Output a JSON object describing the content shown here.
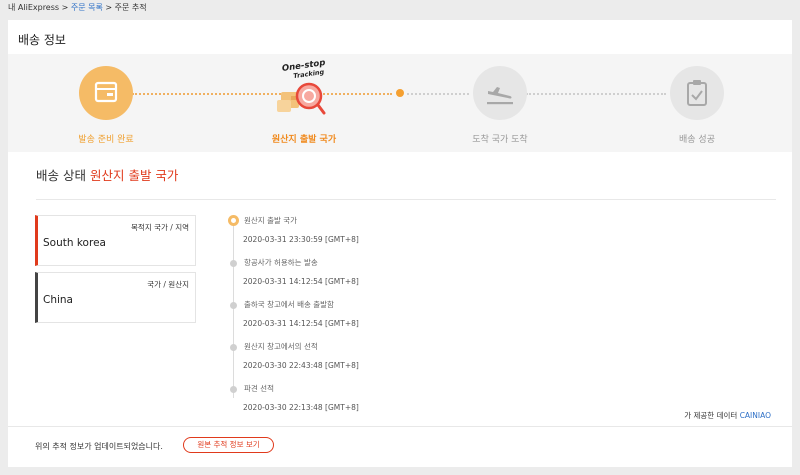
{
  "breadcrumb": {
    "home": "내 AliExpress",
    "sep": ">",
    "orders": "주문 목록",
    "current": "주문 추적"
  },
  "section_title": "배송 정보",
  "steps": [
    {
      "label": "발송 준비 완료",
      "state": "done",
      "icon": "package-icon"
    },
    {
      "label": "원산지 출발 국가",
      "state": "current",
      "icon": "one-stop-tracking-icon",
      "badge_line1": "One-stop",
      "badge_line2": "Tracking"
    },
    {
      "label": "도착 국가 도착",
      "state": "pending",
      "icon": "plane-landing-icon"
    },
    {
      "label": "배송 성공",
      "state": "pending",
      "icon": "clipboard-check-icon"
    }
  ],
  "status": {
    "prefix": "배송 상태",
    "value": "원산지 출발 국가"
  },
  "destination": {
    "caption": "목적지 국가 / 지역",
    "value": "South korea"
  },
  "origin": {
    "caption": "국가 / 원산지",
    "value": "China"
  },
  "timeline": [
    {
      "event": "원산지 출발 국가",
      "time": "2020-03-31 23:30:59 [GMT+8]"
    },
    {
      "event": "항공사가 허용하는 발송",
      "time": "2020-03-31 14:12:54 [GMT+8]"
    },
    {
      "event": "출하국 창고에서 배송 출발함",
      "time": "2020-03-31 14:12:54 [GMT+8]"
    },
    {
      "event": "원산지 창고에서의 선적",
      "time": "2020-03-30 22:43:48 [GMT+8]"
    },
    {
      "event": "파견 선적",
      "time": "2020-03-30 22:13:48 [GMT+8]"
    }
  ],
  "provider": {
    "text": "가 제공한 데이터",
    "brand": "CAINIAO"
  },
  "footer": {
    "note": "위의 추적 정보가 업데이트되었습니다.",
    "button": "원본 추적 정보 보기"
  },
  "colors": {
    "accent": "#e03a1c",
    "orange": "#f0a030",
    "link": "#2d6fc6"
  }
}
